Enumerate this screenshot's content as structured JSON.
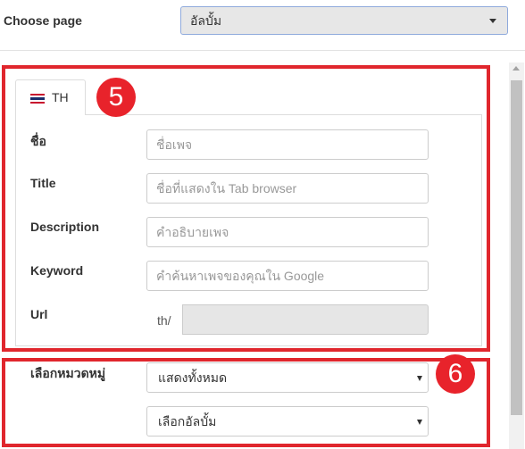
{
  "choose_page": {
    "label": "Choose page",
    "selected": "อัลบั้ม"
  },
  "annotations": {
    "box5_number": "5",
    "box6_number": "6",
    "color": "#e0262d"
  },
  "tab": {
    "label": "TH",
    "flag_icon": "thai-flag-icon"
  },
  "form": {
    "name_label": "ชื่อ",
    "name_placeholder": "ชื่อเพจ",
    "title_label": "Title",
    "title_placeholder": "ชื่อที่แสดงใน Tab browser",
    "description_label": "Description",
    "description_placeholder": "คำอธิบายเพจ",
    "keyword_label": "Keyword",
    "keyword_placeholder": "คำค้นหาเพจของคุณใน Google",
    "url_label": "Url",
    "url_prefix": "th/",
    "url_value": ""
  },
  "category": {
    "label": "เลือกหมวดหมู่",
    "category_selected": "แสดงทั้งหมด",
    "album_selected": "เลือกอัลบั้ม"
  }
}
